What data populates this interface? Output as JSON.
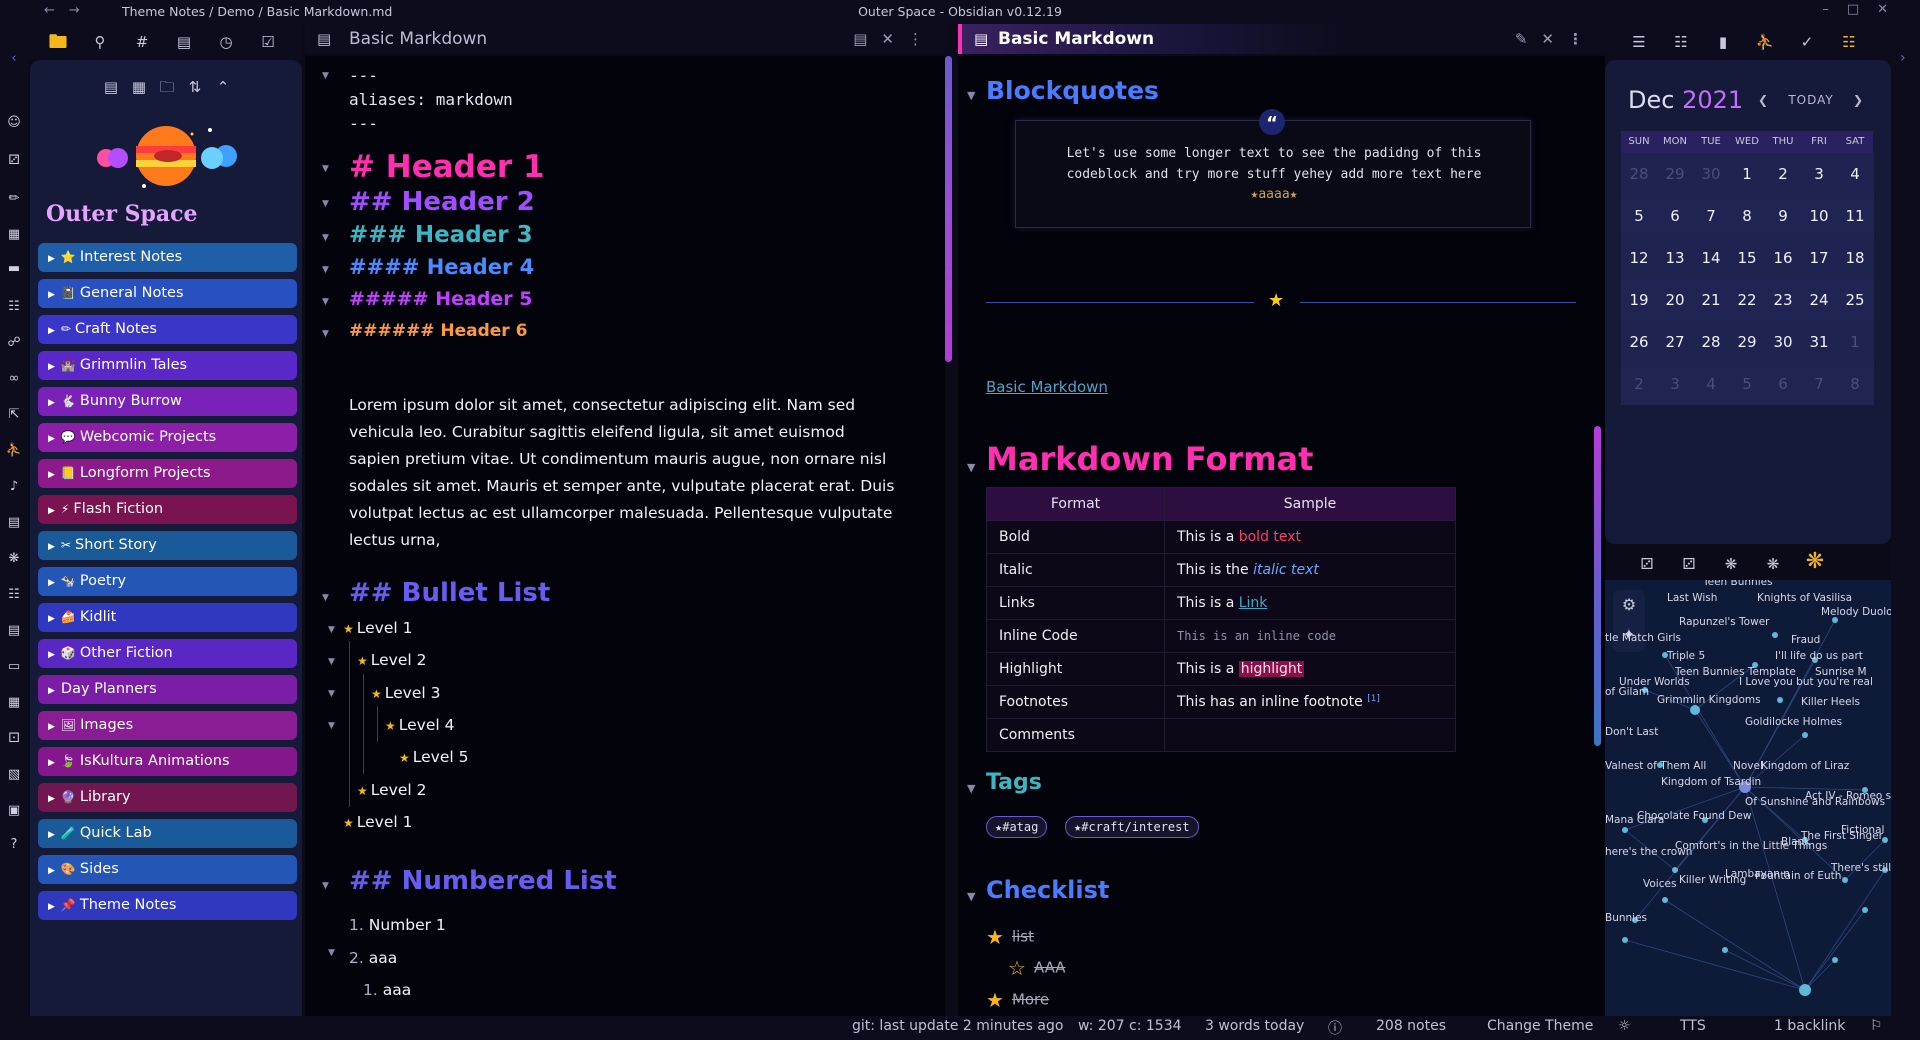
{
  "window": {
    "breadcrumb": "Theme Notes / Demo / Basic Markdown.md",
    "app_title": "Outer Space - Obsidian v0.12.19"
  },
  "sidebar": {
    "vault_name": "Outer Space",
    "folders": [
      {
        "label": "Interest Notes",
        "emoji": "⭐",
        "color": "#1f5fa8"
      },
      {
        "label": "General Notes",
        "emoji": "📓",
        "color": "#2950c0"
      },
      {
        "label": "Craft Notes",
        "emoji": "✏",
        "color": "#3a36c8"
      },
      {
        "label": "Grimmlin Tales",
        "emoji": "🏰",
        "color": "#5a28c8"
      },
      {
        "label": "Bunny Burrow",
        "emoji": "🐇",
        "color": "#7a22b8"
      },
      {
        "label": "Webcomic Projects",
        "emoji": "💬",
        "color": "#8c1ea8"
      },
      {
        "label": "Longform Projects",
        "emoji": "📒",
        "color": "#8c1a8a"
      },
      {
        "label": "Flash Fiction",
        "emoji": "⚡",
        "color": "#7a1450"
      },
      {
        "label": "Short Story",
        "emoji": "✂",
        "color": "#1a5a98"
      },
      {
        "label": "Poetry",
        "emoji": "🐄",
        "color": "#2456b8"
      },
      {
        "label": "Kidlit",
        "emoji": "🍰",
        "color": "#3038c0"
      },
      {
        "label": "Other Fiction",
        "emoji": "🎲",
        "color": "#5a26c4"
      },
      {
        "label": "Day Planners",
        "emoji": "",
        "color": "#7a1ea8"
      },
      {
        "label": "Images",
        "emoji": "🖼",
        "color": "#8a1c94"
      },
      {
        "label": "IsKultura Animations",
        "emoji": "🍃",
        "color": "#86168c"
      },
      {
        "label": "Library",
        "emoji": "🔮",
        "color": "#721650"
      },
      {
        "label": "Quick Lab",
        "emoji": "🧪",
        "color": "#1a5a98"
      },
      {
        "label": "Sides",
        "emoji": "🎨",
        "color": "#2456b8"
      },
      {
        "label": "Theme Notes",
        "emoji": "📌",
        "color": "#3038c0"
      }
    ]
  },
  "left_pane": {
    "title": "Basic Markdown",
    "frontmatter": [
      "---",
      "aliases: markdown",
      "---"
    ],
    "headers": [
      "# Header 1",
      "## Header 2",
      "### Header 3",
      "#### Header 4",
      "##### Header 5",
      "###### Header 6"
    ],
    "lorem": "Lorem ipsum dolor sit amet, consectetur adipiscing elit. Nam sed vehicula leo. Curabitur sagittis eleifend ligula, sit amet euismod sapien pretium vitae. Ut condimentum mauris augue, non ornare nisl sodales sit amet. Mauris et semper ante, vulputate placerat erat. Duis volutpat lectus ac est ullamcorper malesuada. Pellentesque vulputate lectus urna,",
    "bullet_heading": "## Bullet List",
    "bullets": [
      "Level 1",
      "Level 2",
      "Level 3",
      "Level 4",
      "Level 5",
      "Level 2",
      "Level 1"
    ],
    "numbered_heading": "## Numbered List",
    "numbered": [
      {
        "num": "1.",
        "text": "Number 1"
      },
      {
        "num": "2.",
        "text": "aaa"
      },
      {
        "num": "1.",
        "text": "aaa"
      }
    ]
  },
  "right_pane": {
    "title": "Basic Markdown",
    "blockquotes_heading": "Blockquotes",
    "quote_text": "Let's use some longer text to see the padidng of this codeblock and try more stuff yehey add more text here",
    "quote_sig": "★aaaa★",
    "link_text": "Basic Markdown",
    "markdown_format_heading": "Markdown Format",
    "table": {
      "headers": [
        "Format",
        "Sample"
      ],
      "rows": [
        {
          "format": "Bold",
          "prefix": "This is a ",
          "sample": "bold text"
        },
        {
          "format": "Italic",
          "prefix": "This is the ",
          "sample": "italic text"
        },
        {
          "format": "Links",
          "prefix": "This is a ",
          "sample": "Link"
        },
        {
          "format": "Inline Code",
          "prefix": "",
          "sample": "This is an inline code"
        },
        {
          "format": "Highlight",
          "prefix": "This is a ",
          "sample": "highlight"
        },
        {
          "format": "Footnotes",
          "prefix": "This has an inline footnote",
          "sample": "[1]"
        },
        {
          "format": "Comments",
          "prefix": "",
          "sample": ""
        }
      ]
    },
    "tags_heading": "Tags",
    "tags": [
      "★#atag",
      "★#craft/interest"
    ],
    "checklist_heading": "Checklist",
    "checklist": [
      "list",
      "AAA",
      "More"
    ]
  },
  "calendar": {
    "month": "Dec",
    "year": "2021",
    "today_label": "TODAY",
    "weekdays": [
      "SUN",
      "MON",
      "TUE",
      "WED",
      "THU",
      "FRI",
      "SAT"
    ],
    "weeks": [
      [
        "28",
        "29",
        "30",
        "1",
        "2",
        "3",
        "4"
      ],
      [
        "5",
        "6",
        "7",
        "8",
        "9",
        "10",
        "11"
      ],
      [
        "12",
        "13",
        "14",
        "15",
        "16",
        "17",
        "18"
      ],
      [
        "19",
        "20",
        "21",
        "22",
        "23",
        "24",
        "25"
      ],
      [
        "26",
        "27",
        "28",
        "29",
        "30",
        "31",
        "1"
      ],
      [
        "2",
        "3",
        "4",
        "5",
        "6",
        "7",
        "8"
      ]
    ]
  },
  "graph": {
    "labels": [
      "Teen Bunnies",
      "Last Wish",
      "Knights of Vasilisa",
      "Melody Duology",
      "Rapunzel's Tower",
      "Fraud",
      "tle Match Girls",
      "Triple 5",
      "I'll life do us part",
      "Teen Bunnies Template",
      "Sunrise M",
      "Under Worlds",
      "I Love you but you're real",
      "of Gilam",
      "Grimmlin Kingdoms",
      "Killer Heels",
      "Goldilocke Holmes",
      "Don't Last",
      "Novel",
      "Kingdom of Liraz",
      "Valnest of Them All",
      "Kingdom of Tsardin",
      "Of Sunshine and Rainbows",
      "Chocolate Found Dew",
      "Mana Clara",
      "Comfort's in the Little Things",
      "The First Singer",
      "Fictional",
      "here's the crown",
      "Lambayan n",
      "Fountain of Euth",
      "Voices",
      "Killer Writing",
      "Bunnies",
      "Act IV - Romeo san",
      "Blank",
      "There's still tor"
    ]
  },
  "status": {
    "git": "git: last update 2 minutes ago",
    "counts": "w: 207 c: 1534",
    "today": "3 words today",
    "notes": "208 notes",
    "theme": "Change Theme",
    "tts": "TTS",
    "backlinks": "1 backlink"
  }
}
